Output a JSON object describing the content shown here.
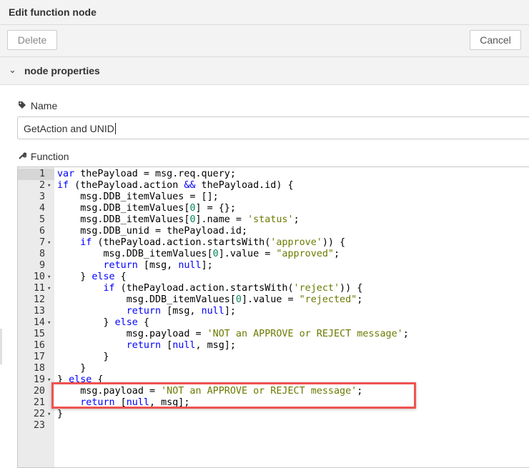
{
  "dialog": {
    "title": "Edit function node",
    "delete_label": "Delete",
    "cancel_label": "Cancel",
    "section_label": "node properties"
  },
  "name_field": {
    "label": "Name",
    "value": "GetAction and UNID",
    "icon": "tag-icon"
  },
  "function_field": {
    "label": "Function",
    "icon": "wrench-icon"
  },
  "code_lines": [
    {
      "n": "1",
      "fold": false,
      "html": "<span class=\"kw\">var</span> thePayload = msg.req.query;"
    },
    {
      "n": "2",
      "fold": true,
      "html": "<span class=\"kw\">if</span> (thePayload.action <span class=\"op\">&amp;&amp;</span> thePayload.id) {"
    },
    {
      "n": "3",
      "fold": false,
      "html": "    msg.DDB_itemValues = [];"
    },
    {
      "n": "4",
      "fold": false,
      "html": "    msg.DDB_itemValues[<span class=\"num-lit\">0</span>] = {};"
    },
    {
      "n": "5",
      "fold": false,
      "html": "    msg.DDB_itemValues[<span class=\"num-lit\">0</span>].name = <span class=\"str\">'status'</span>;"
    },
    {
      "n": "6",
      "fold": false,
      "html": "    msg.DDB_unid = thePayload.id;"
    },
    {
      "n": "7",
      "fold": true,
      "html": "    <span class=\"kw\">if</span> (thePayload.action.startsWith(<span class=\"str\">'approve'</span>)) {"
    },
    {
      "n": "8",
      "fold": false,
      "html": "        msg.DDB_itemValues[<span class=\"num-lit\">0</span>].value = <span class=\"str\">\"approved\"</span>;"
    },
    {
      "n": "9",
      "fold": false,
      "html": "        <span class=\"kw\">return</span> [msg, <span class=\"kw\">null</span>];"
    },
    {
      "n": "10",
      "fold": true,
      "html": "    } <span class=\"kw\">else</span> {"
    },
    {
      "n": "11",
      "fold": true,
      "html": "        <span class=\"kw\">if</span> (thePayload.action.startsWith(<span class=\"str\">'reject'</span>)) {"
    },
    {
      "n": "12",
      "fold": false,
      "html": "            msg.DDB_itemValues[<span class=\"num-lit\">0</span>].value = <span class=\"str\">\"rejected\"</span>;"
    },
    {
      "n": "13",
      "fold": false,
      "html": "            <span class=\"kw\">return</span> [msg, <span class=\"kw\">null</span>];"
    },
    {
      "n": "14",
      "fold": true,
      "html": "        } <span class=\"kw\">else</span> {"
    },
    {
      "n": "15",
      "fold": false,
      "html": "            msg.payload = <span class=\"str\">'NOT an APPROVE or REJECT message'</span>;"
    },
    {
      "n": "16",
      "fold": false,
      "html": "            <span class=\"kw\">return</span> [<span class=\"kw\">null</span>, msg];"
    },
    {
      "n": "17",
      "fold": false,
      "html": "        }"
    },
    {
      "n": "18",
      "fold": false,
      "html": "    }"
    },
    {
      "n": "19",
      "fold": true,
      "html": "} <span class=\"kw\">else</span> {"
    },
    {
      "n": "20",
      "fold": false,
      "html": "    msg.payload = <span class=\"str\">'NOT an APPROVE or REJECT message'</span>;"
    },
    {
      "n": "21",
      "fold": false,
      "html": "    <span class=\"kw\">return</span> [<span class=\"kw\">null</span>, msg];"
    },
    {
      "n": "22",
      "fold": true,
      "html": "}"
    },
    {
      "n": "23",
      "fold": false,
      "html": ""
    }
  ],
  "colors": {
    "keyword": "#0000ff",
    "string": "#6c7a00",
    "number": "#09885a",
    "highlight_border": "#ef5350"
  }
}
